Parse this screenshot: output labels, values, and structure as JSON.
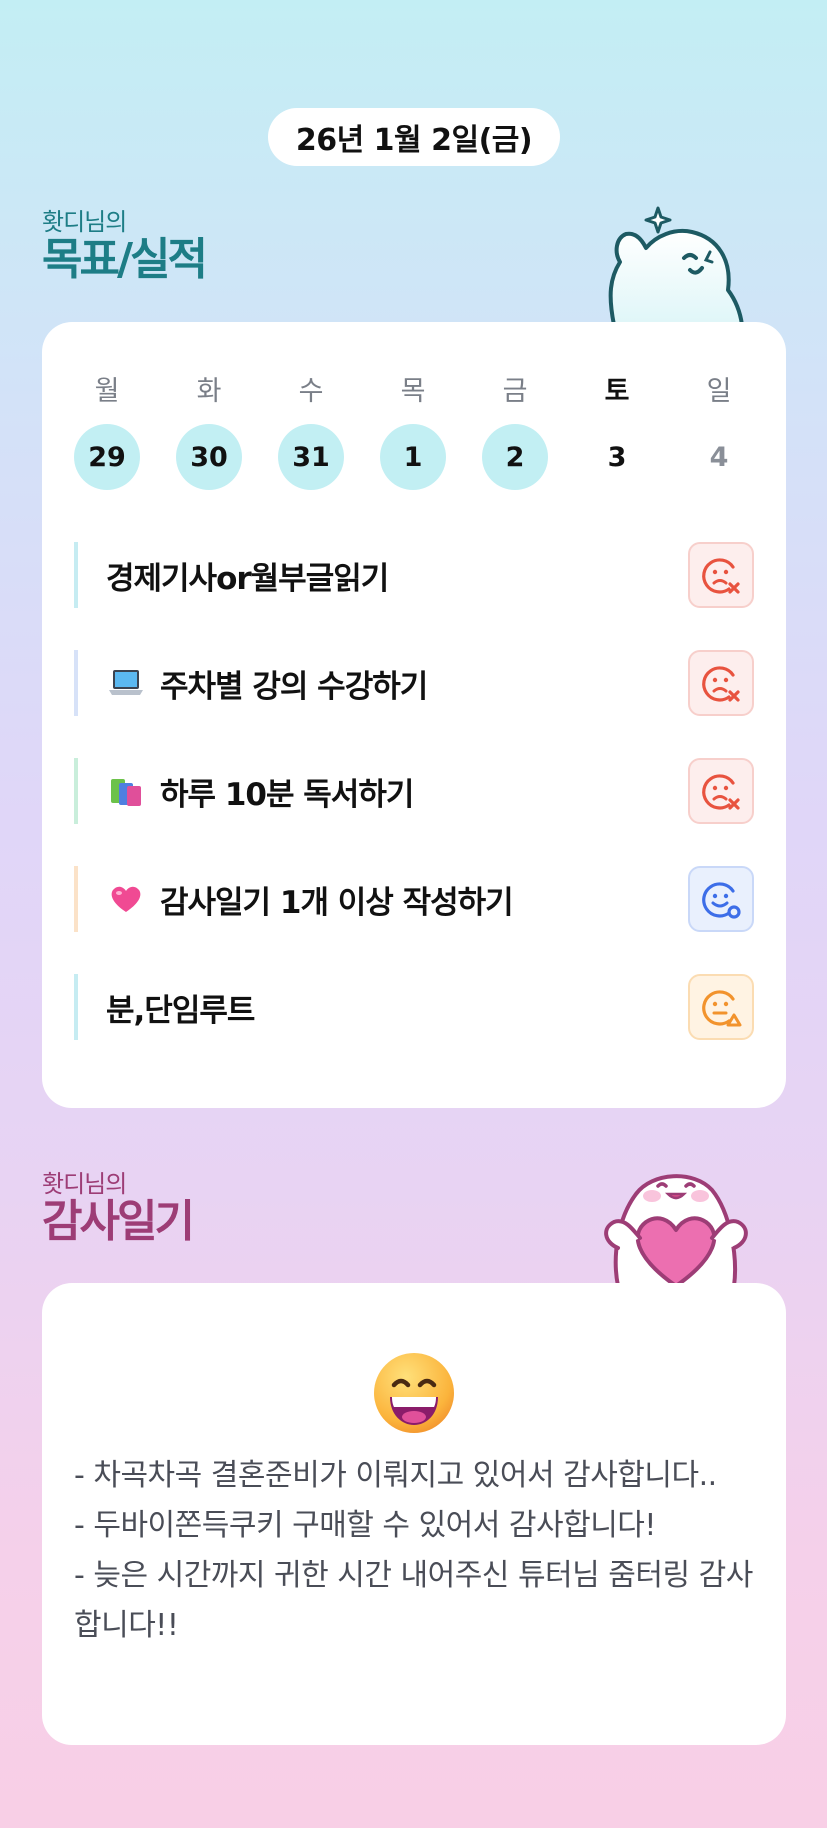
{
  "date": "26년 1월 2일(금)",
  "goals_section": {
    "sub": "홧디님의",
    "title": "목표/실적"
  },
  "week": {
    "days": [
      {
        "name": "월",
        "num": "29",
        "state": "done"
      },
      {
        "name": "화",
        "num": "30",
        "state": "done"
      },
      {
        "name": "수",
        "num": "31",
        "state": "done"
      },
      {
        "name": "목",
        "num": "1",
        "state": "done"
      },
      {
        "name": "금",
        "num": "2",
        "state": "done"
      },
      {
        "name": "토",
        "num": "3",
        "state": "today"
      },
      {
        "name": "일",
        "num": "4",
        "state": "future"
      }
    ]
  },
  "goals": [
    {
      "icon": "none",
      "label": "경제기사or월부글읽기",
      "status": "fail",
      "bar_color": "#c6ecf2"
    },
    {
      "icon": "laptop-icon",
      "label": "주차별 강의 수강하기",
      "status": "fail",
      "bar_color": "#d7e2f8"
    },
    {
      "icon": "books-icon",
      "label": "하루 10분 독서하기",
      "status": "fail",
      "bar_color": "#c9eedb"
    },
    {
      "icon": "heart-icon",
      "label": "감사일기 1개 이상 작성하기",
      "status": "good",
      "bar_color": "#fbe2c8"
    },
    {
      "icon": "none",
      "label": "분,단임루트",
      "status": "partial",
      "bar_color": "#c6ecf2"
    }
  ],
  "diary_section": {
    "sub": "홧디님의",
    "title": "감사일기"
  },
  "diary": {
    "emoji": "grinning-face-icon",
    "lines": [
      "- 차곡차곡 결혼준비가 이뤄지고 있어서 감사합니다..",
      "- 두바이쫀득쿠키 구매할 수 있어서 감사합니다!",
      "- 늦은 시간까지 귀한 시간 내어주신 튜터님 줌터링 감사합니다!!"
    ]
  },
  "colors": {
    "goals_title": "#1d7d86",
    "diary_title": "#9d3d76",
    "done_day": "#c2eff3",
    "fail": "#e8533f",
    "good": "#3d6ee8",
    "partial": "#f2932d"
  }
}
